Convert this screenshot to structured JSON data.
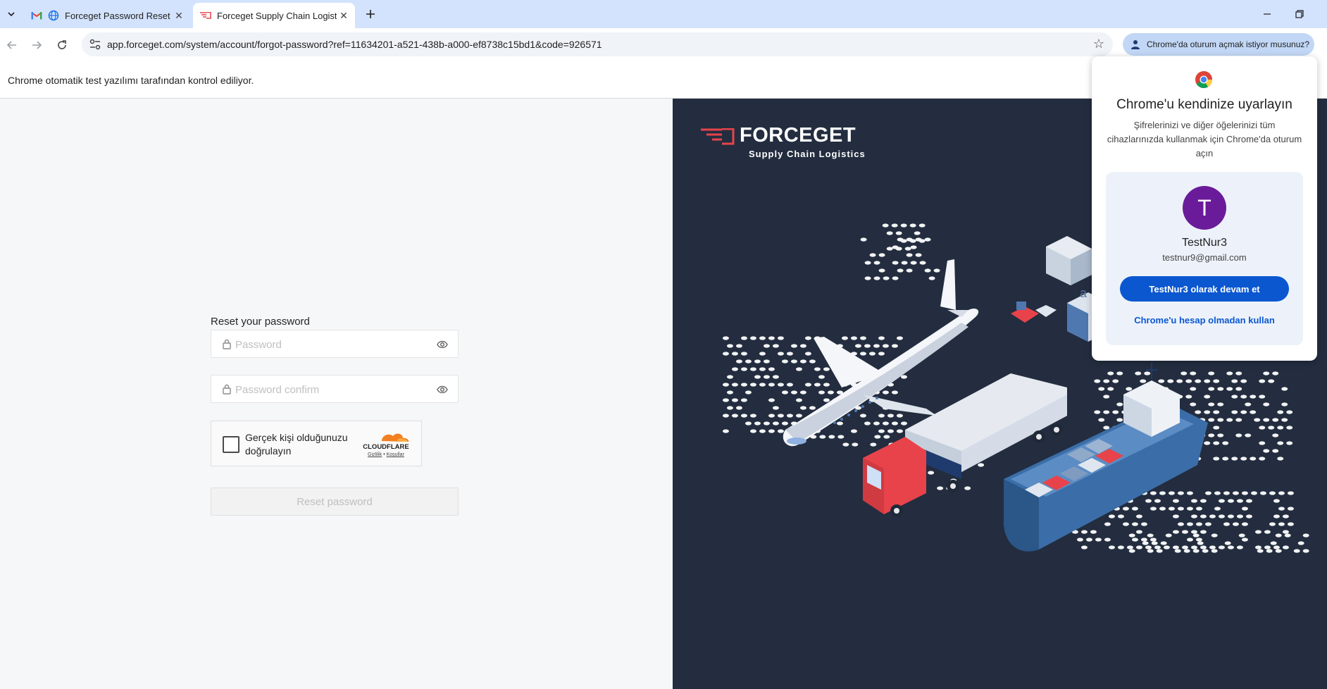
{
  "browser": {
    "tabs": [
      {
        "title": "Forceget Password Reset - t",
        "active": false
      },
      {
        "title": "Forceget Supply Chain Logistics",
        "active": true
      }
    ],
    "url": "app.forceget.com/system/account/forgot-password?ref=11634201-a521-438b-a000-ef8738c15bd1&code=926571",
    "signin_chip": "Chrome'da oturum açmak istiyor musunuz?",
    "infobar": "Chrome otomatik test yazılımı tarafından kontrol ediliyor."
  },
  "form": {
    "title": "Reset your password",
    "password_placeholder": "Password",
    "confirm_placeholder": "Password confirm",
    "captcha_text": "Gerçek kişi olduğunuzu doğrulayın",
    "captcha_brand": "CLOUDFLARE",
    "captcha_privacy": "Gizlilik",
    "captcha_sep": "•",
    "captcha_terms": "Koşullar",
    "submit": "Reset password"
  },
  "brand": {
    "name": "FORCEGET",
    "tagline": "Supply Chain Logistics"
  },
  "popup": {
    "title": "Chrome'u kendinize uyarlayın",
    "description": "Şifrelerinizi ve diğer öğelerinizi tüm cihazlarınızda kullanmak için Chrome'da oturum açın",
    "avatar_letter": "T",
    "user_name": "TestNur3",
    "user_email": "testnur9@gmail.com",
    "continue_button": "TestNur3 olarak devam et",
    "no_account_link": "Chrome'u hesap olmadan kullan"
  },
  "colors": {
    "accent": "#0b57d0",
    "dark_panel": "#232d3f",
    "brand_red": "#e8434b",
    "avatar": "#6a1b9a"
  }
}
